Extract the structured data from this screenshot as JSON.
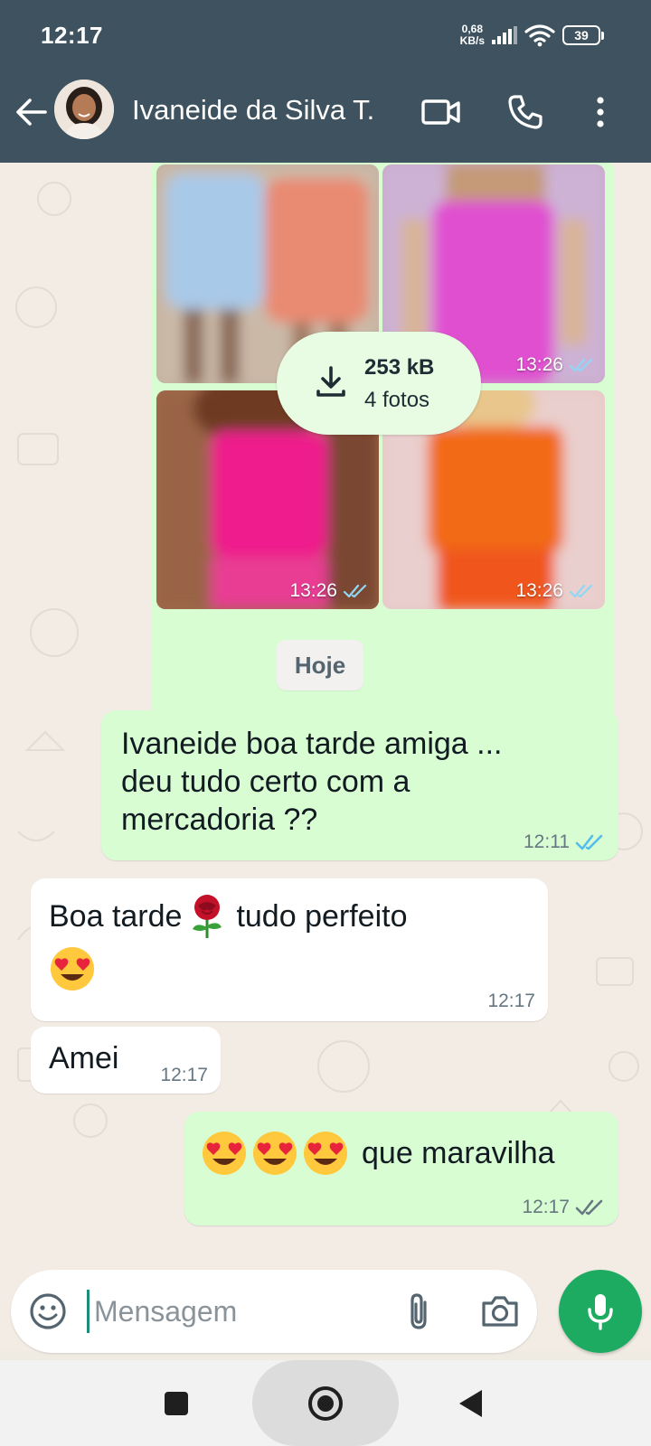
{
  "status_bar": {
    "time": "12:17",
    "net_speed_value": "0,68",
    "net_speed_unit": "KB/s",
    "battery": "39"
  },
  "header": {
    "contact_name": "Ivaneide da Silva T.",
    "icons": [
      "back-arrow-icon",
      "video-call-icon",
      "phone-icon",
      "more-options-icon"
    ]
  },
  "album": {
    "size": "253 kB",
    "count": "4 fotos",
    "photos": [
      {
        "time": ""
      },
      {
        "time": "13:26"
      },
      {
        "time": "13:26"
      },
      {
        "time": "13:26"
      }
    ]
  },
  "date_chip": "Hoje",
  "messages": [
    {
      "dir": "out",
      "line1": "Ivaneide boa tarde amiga ...",
      "line2": "deu tudo certo com a",
      "line3": "mercadoria ??",
      "time": "12:11",
      "read": true
    },
    {
      "dir": "in",
      "text_before": "Boa tarde",
      "text_after": "tudo perfeito",
      "time": "12:17"
    },
    {
      "dir": "in",
      "text": "Amei",
      "time": "12:17"
    },
    {
      "dir": "out",
      "text": "que maravilha",
      "time": "12:17",
      "read": false
    }
  ],
  "composer": {
    "placeholder": "Mensagem"
  },
  "colors": {
    "header": "#3e535f",
    "outgoing_bubble": "#d9fdd3",
    "incoming_bubble": "#ffffff",
    "accent": "#1dab61",
    "read_ticks": "#53bdeb"
  }
}
